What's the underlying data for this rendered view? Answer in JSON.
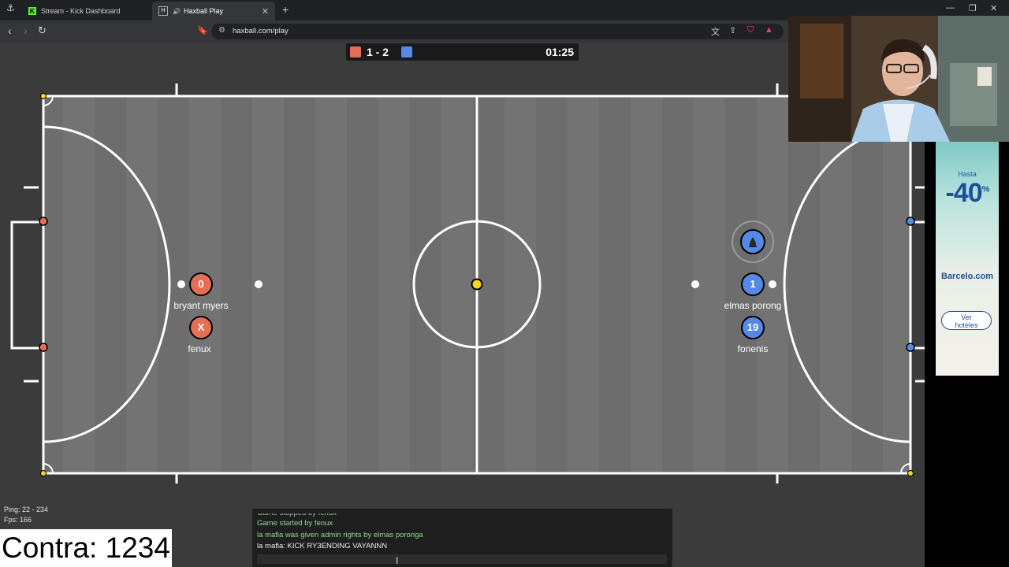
{
  "browser": {
    "tabs": [
      {
        "label": "Stream - Kick Dashboard",
        "active": false
      },
      {
        "label": "Haxball Play",
        "active": true
      }
    ],
    "url": "haxball.com/play"
  },
  "scoreboard": {
    "red_score": "1",
    "separator": "-",
    "blue_score": "2",
    "score_text": "1 - 2",
    "time": "01:25"
  },
  "players": {
    "red": [
      {
        "number": "0",
        "name": "bryant myers"
      },
      {
        "number": "X",
        "name": "fenux"
      }
    ],
    "blue": [
      {
        "number": "1",
        "name": "elmas porong"
      },
      {
        "number": "19",
        "name": "fonenis"
      }
    ]
  },
  "stats": {
    "ping": "Ping: 22 - 234",
    "fps": "Fps: 166"
  },
  "overlay": {
    "text": "Contra: 1234"
  },
  "chat": {
    "messages": [
      {
        "text": "Game stopped by fenux",
        "color": "green"
      },
      {
        "text": "Game started by fenux",
        "color": "green"
      },
      {
        "text": "la mafia was given admin rights by elmas poronga",
        "color": "green"
      },
      {
        "text": "la mafia: KICK RY3ENDING VAYANNN",
        "color": "white"
      }
    ]
  },
  "ad": {
    "hasta": "Hasta",
    "discount": "-40",
    "discount_sup": "%",
    "brand": "Barcelo.com",
    "cta_line1": "Ver",
    "cta_line2": "hoteles"
  },
  "colors": {
    "red_team": "#e56e56",
    "blue_team": "#5689e5",
    "ball": "#f5d51e",
    "field": "#717171"
  }
}
